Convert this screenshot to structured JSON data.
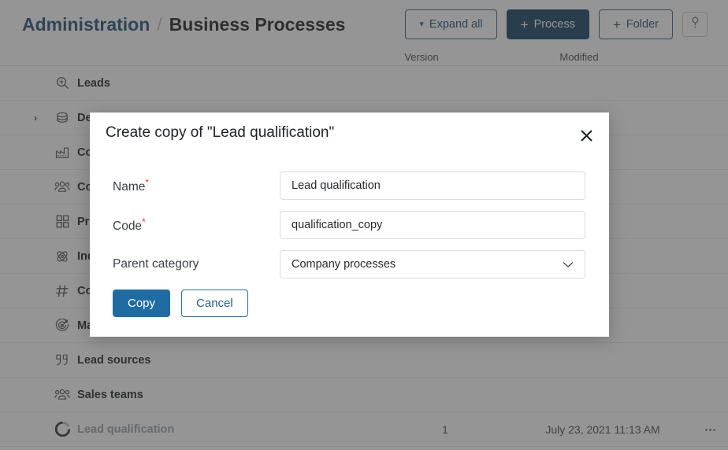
{
  "header": {
    "breadcrumb": {
      "root": "Administration",
      "separator": "/",
      "current": "Business Processes"
    },
    "buttons": {
      "expand_all": "Expand all",
      "add_process": "Process",
      "add_folder": "Folder",
      "plus": "+",
      "help_icon": "question-mark-icon"
    }
  },
  "table": {
    "columns": {
      "name": "",
      "version": "Version",
      "modified": "Modified",
      "menu": ""
    },
    "rows": [
      {
        "label": "Leads",
        "icon": "lead-search-icon",
        "twisty": "",
        "version": "",
        "modified": "",
        "menu": ""
      },
      {
        "label": "Deals",
        "icon": "deals-stack-icon",
        "twisty": "›",
        "version": "",
        "modified": "",
        "menu": ""
      },
      {
        "label": "Companies",
        "icon": "factory-icon",
        "twisty": "",
        "version": "",
        "modified": "",
        "menu": ""
      },
      {
        "label": "Contacts",
        "icon": "people-icon",
        "twisty": "",
        "version": "",
        "modified": "",
        "menu": ""
      },
      {
        "label": "Products",
        "icon": "grid-squares-icon",
        "twisty": "",
        "version": "",
        "modified": "",
        "menu": ""
      },
      {
        "label": "Industries",
        "icon": "atom-icon",
        "twisty": "",
        "version": "",
        "modified": "",
        "menu": ""
      },
      {
        "label": "Common",
        "icon": "hash-icon",
        "twisty": "",
        "version": "",
        "modified": "",
        "menu": ""
      },
      {
        "label": "Marketing",
        "icon": "target-icon",
        "twisty": "",
        "version": "",
        "modified": "",
        "menu": ""
      },
      {
        "label": "Lead sources",
        "icon": "quote-icon",
        "twisty": "",
        "version": "",
        "modified": "",
        "menu": ""
      },
      {
        "label": "Sales teams",
        "icon": "people-icon",
        "twisty": "",
        "version": "",
        "modified": "",
        "menu": ""
      },
      {
        "label": "Lead qualification",
        "icon": "donut-icon",
        "twisty": "",
        "version": "1",
        "modified": "July 23, 2021 11:13 AM",
        "menu": "⋯",
        "dim": true
      }
    ]
  },
  "modal": {
    "title": "Create copy of \"Lead qualification\"",
    "close_icon": "close-x-icon",
    "fields": {
      "name": {
        "label": "Name",
        "required_mark": "*",
        "value": "Lead qualification",
        "placeholder": ""
      },
      "code": {
        "label": "Code",
        "required_mark": "*",
        "value": "qualification_copy",
        "placeholder": ""
      },
      "parent_category": {
        "label": "Parent category",
        "required_mark": "",
        "value": "Company processes",
        "chevron": "chevron-down-icon"
      }
    },
    "actions": {
      "confirm": "Copy",
      "cancel": "Cancel"
    }
  },
  "colors": {
    "brand_dark": "#113f5e",
    "brand_link": "#1b4f72",
    "primary_button": "#1f6ca3",
    "required_red": "#e0392b",
    "overlay": "rgba(62,62,62,0.55)"
  }
}
